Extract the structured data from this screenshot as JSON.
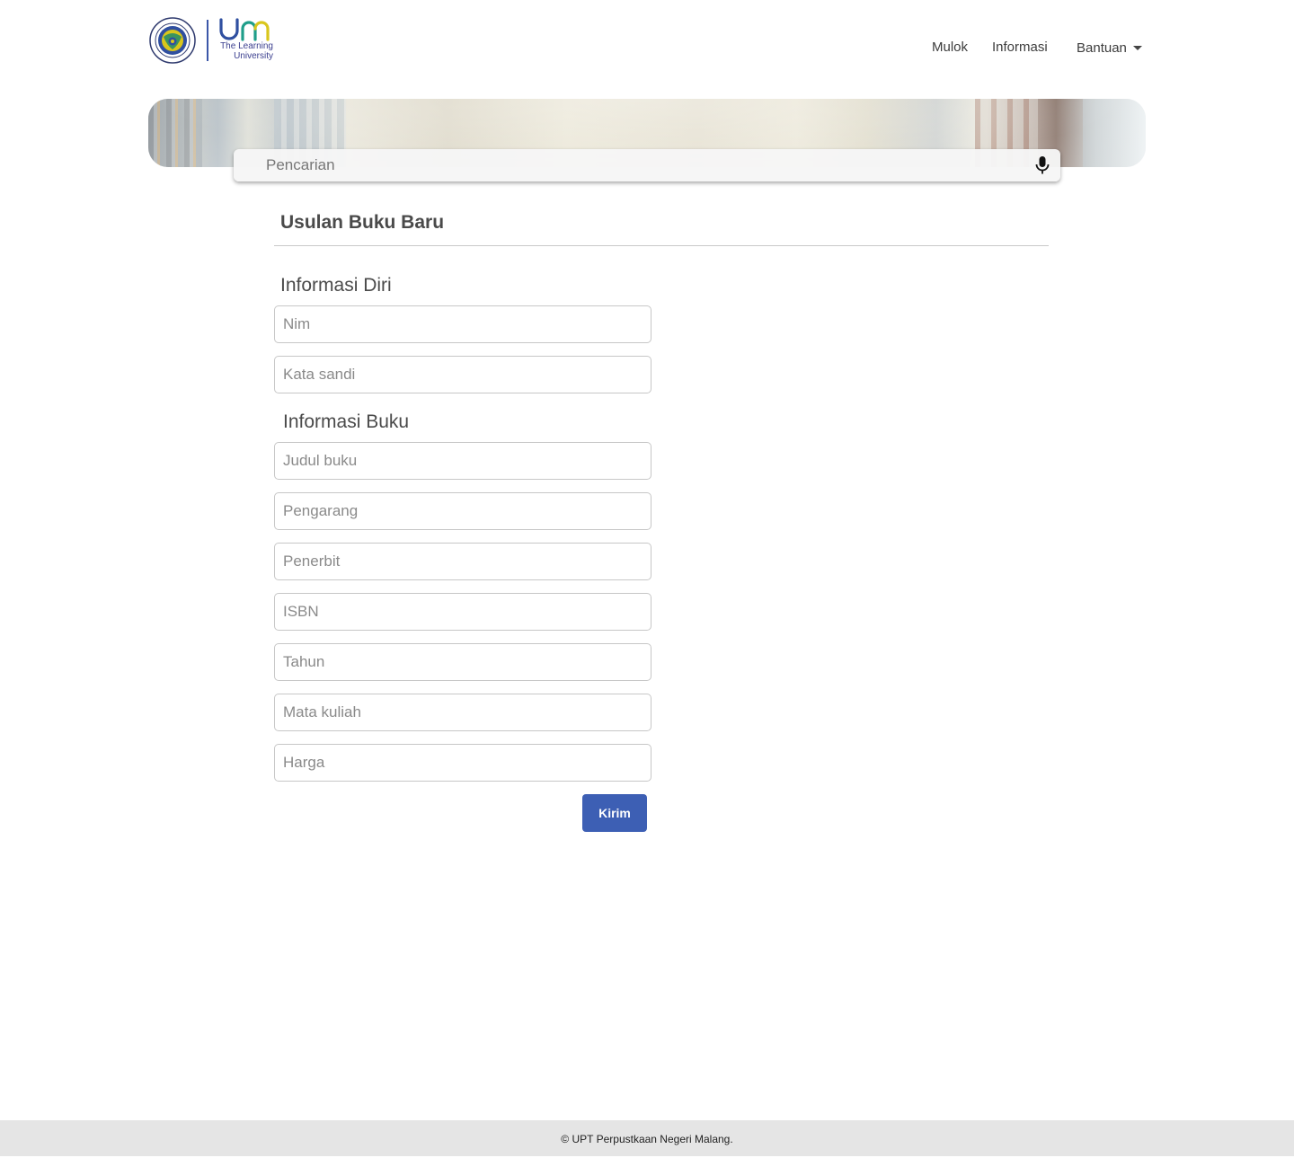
{
  "header": {
    "logo": {
      "mark_text": "um",
      "tagline_line1": "The Learning",
      "tagline_line2": "University",
      "seal_text": "UNIVERSITAS NEGERI MALANG",
      "colors": {
        "primary": "#3b57a8",
        "accent_yellow": "#d9c61c",
        "accent_green": "#1f8b6a"
      }
    },
    "nav": {
      "mulok": "Mulok",
      "informasi": "Informasi",
      "bantuan": "Bantuan"
    }
  },
  "search": {
    "placeholder": "Pencarian",
    "value": "",
    "icon": "microphone-icon"
  },
  "form": {
    "title": "Usulan Buku Baru",
    "section_personal": "Informasi Diri",
    "section_book": "Informasi Buku",
    "fields": {
      "nim": {
        "placeholder": "Nim",
        "value": ""
      },
      "password": {
        "placeholder": "Kata sandi",
        "value": ""
      },
      "title": {
        "placeholder": "Judul buku",
        "value": ""
      },
      "author": {
        "placeholder": "Pengarang",
        "value": ""
      },
      "publisher": {
        "placeholder": "Penerbit",
        "value": ""
      },
      "isbn": {
        "placeholder": "ISBN",
        "value": ""
      },
      "year": {
        "placeholder": "Tahun",
        "value": ""
      },
      "course": {
        "placeholder": "Mata kuliah",
        "value": ""
      },
      "price": {
        "placeholder": "Harga",
        "value": ""
      }
    },
    "submit_label": "Kirim",
    "submit_color": "#3d5fb4"
  },
  "footer": {
    "text": "© UPT Perpustkaan Negeri Malang."
  }
}
